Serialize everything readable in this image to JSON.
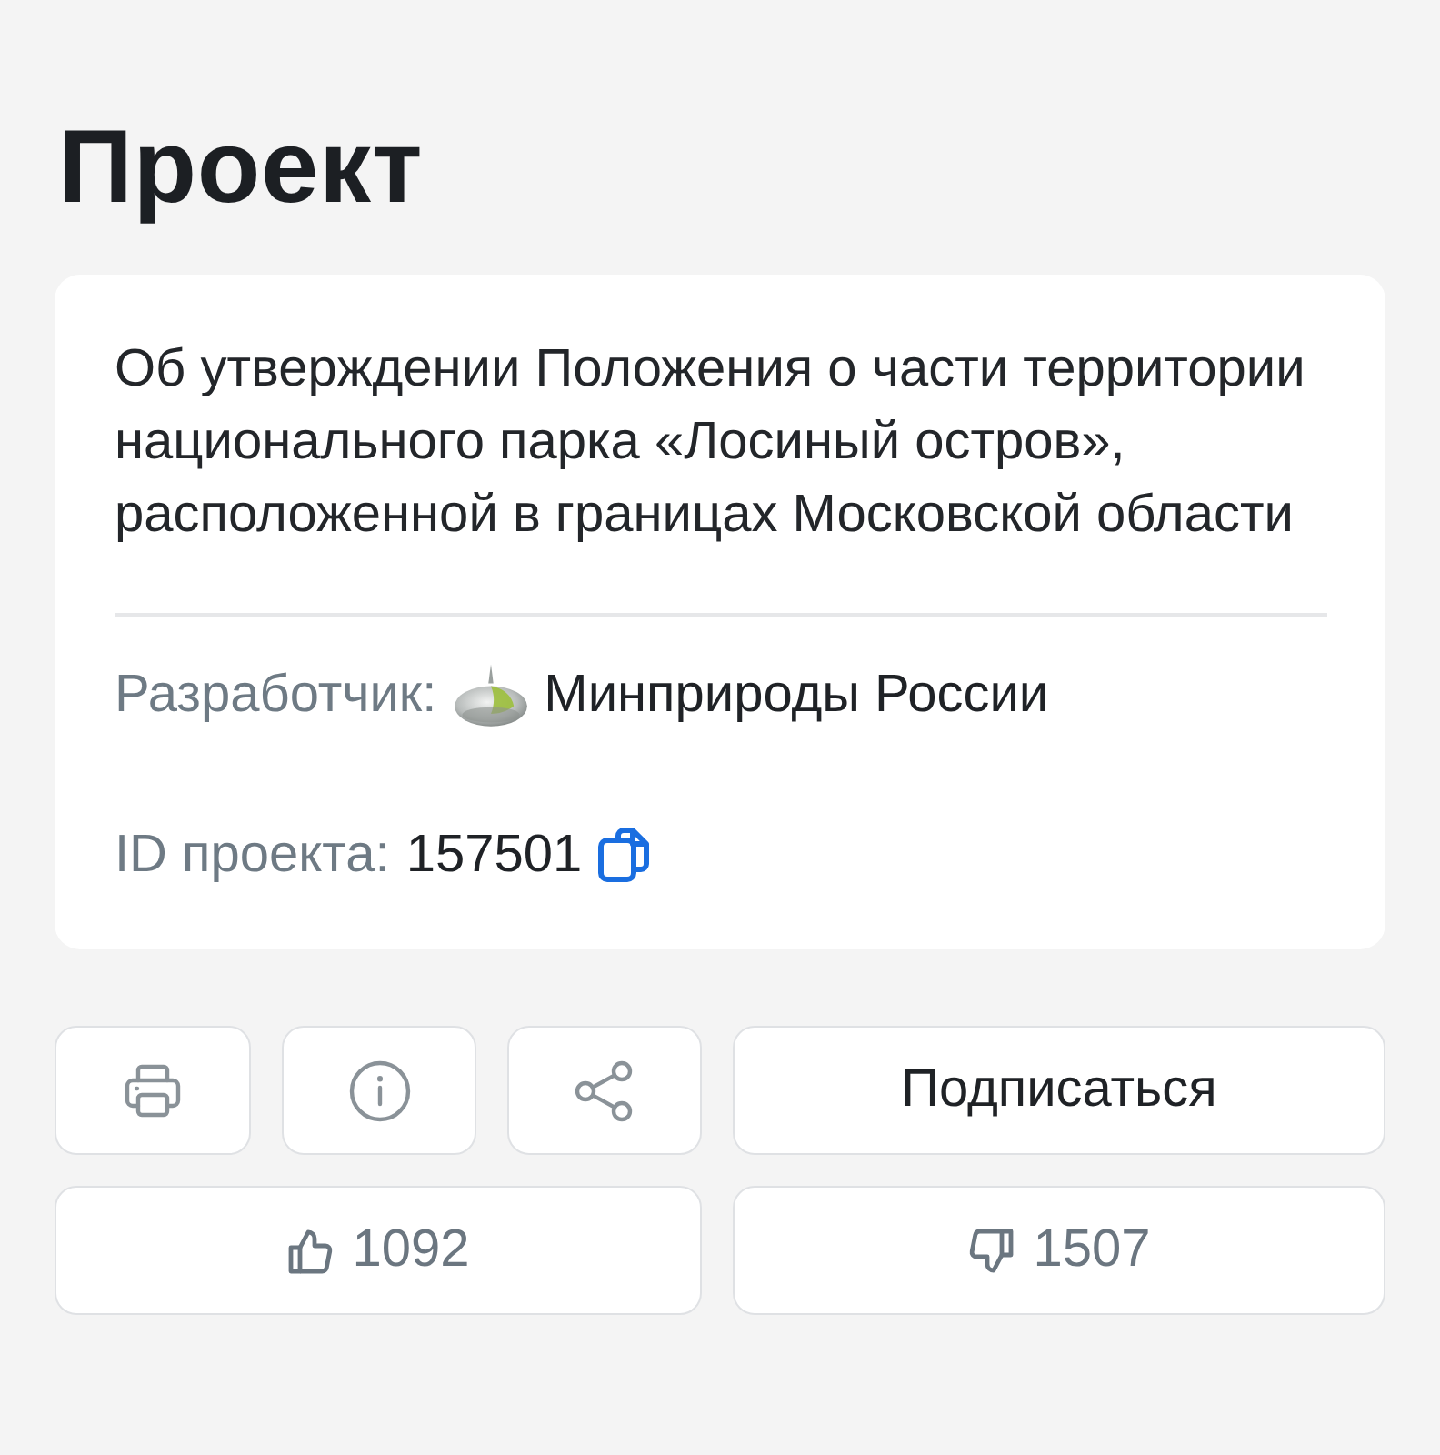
{
  "page": {
    "title": "Проект"
  },
  "project": {
    "description": "Об утверждении Положения о части территории национального парка «Лосиный остров», расположенной в границах Московской области",
    "developer": {
      "label": "Разработчик:",
      "name": "Минприроды России"
    },
    "project_id": {
      "label": "ID проекта:",
      "value": "157501"
    }
  },
  "subscribe_button": {
    "label": "Подписаться"
  },
  "votes": {
    "likes": "1092",
    "dislikes": "1507"
  }
}
